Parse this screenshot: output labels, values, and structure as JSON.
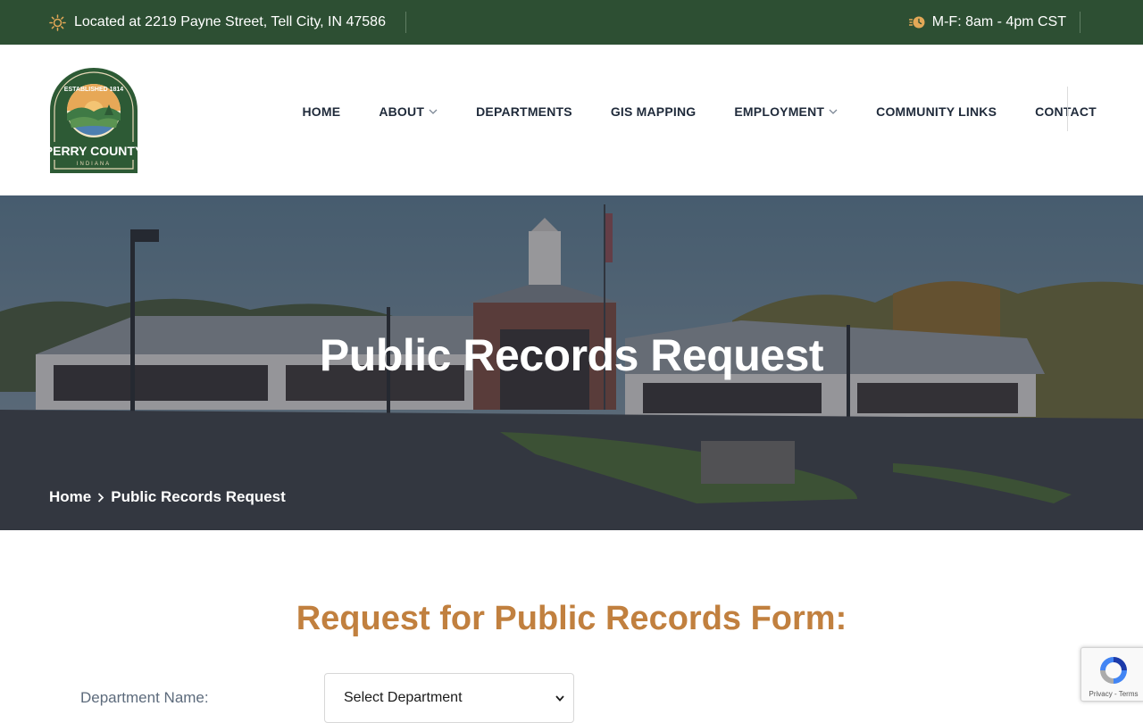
{
  "topbar": {
    "location": "Located at 2219 Payne Street, Tell City, IN 47586",
    "hours": "M-F: 8am - 4pm CST",
    "location_icon": "sun-icon",
    "hours_icon": "clock-icon"
  },
  "logo": {
    "established": "ESTABLISHED 1814",
    "name": "PERRY COUNTY",
    "state": "INDIANA"
  },
  "nav": {
    "items": [
      {
        "label": "HOME",
        "has_dropdown": false
      },
      {
        "label": "ABOUT",
        "has_dropdown": true
      },
      {
        "label": "DEPARTMENTS",
        "has_dropdown": false
      },
      {
        "label": "GIS MAPPING",
        "has_dropdown": false
      },
      {
        "label": "EMPLOYMENT",
        "has_dropdown": true
      },
      {
        "label": "COMMUNITY LINKS",
        "has_dropdown": false
      },
      {
        "label": "CONTACT",
        "has_dropdown": false
      }
    ]
  },
  "hero": {
    "title": "Public Records Request",
    "breadcrumb": {
      "home": "Home",
      "current": "Public Records Request"
    }
  },
  "form": {
    "title": "Request for Public Records Form:",
    "department_label": "Department Name:",
    "department_selected": "Select Department"
  },
  "recaptcha": {
    "links": "Privacy - Terms"
  },
  "colors": {
    "topbar_bg": "#2d4f33",
    "accent": "#c1803f",
    "nav_text": "#1f2a3a"
  }
}
